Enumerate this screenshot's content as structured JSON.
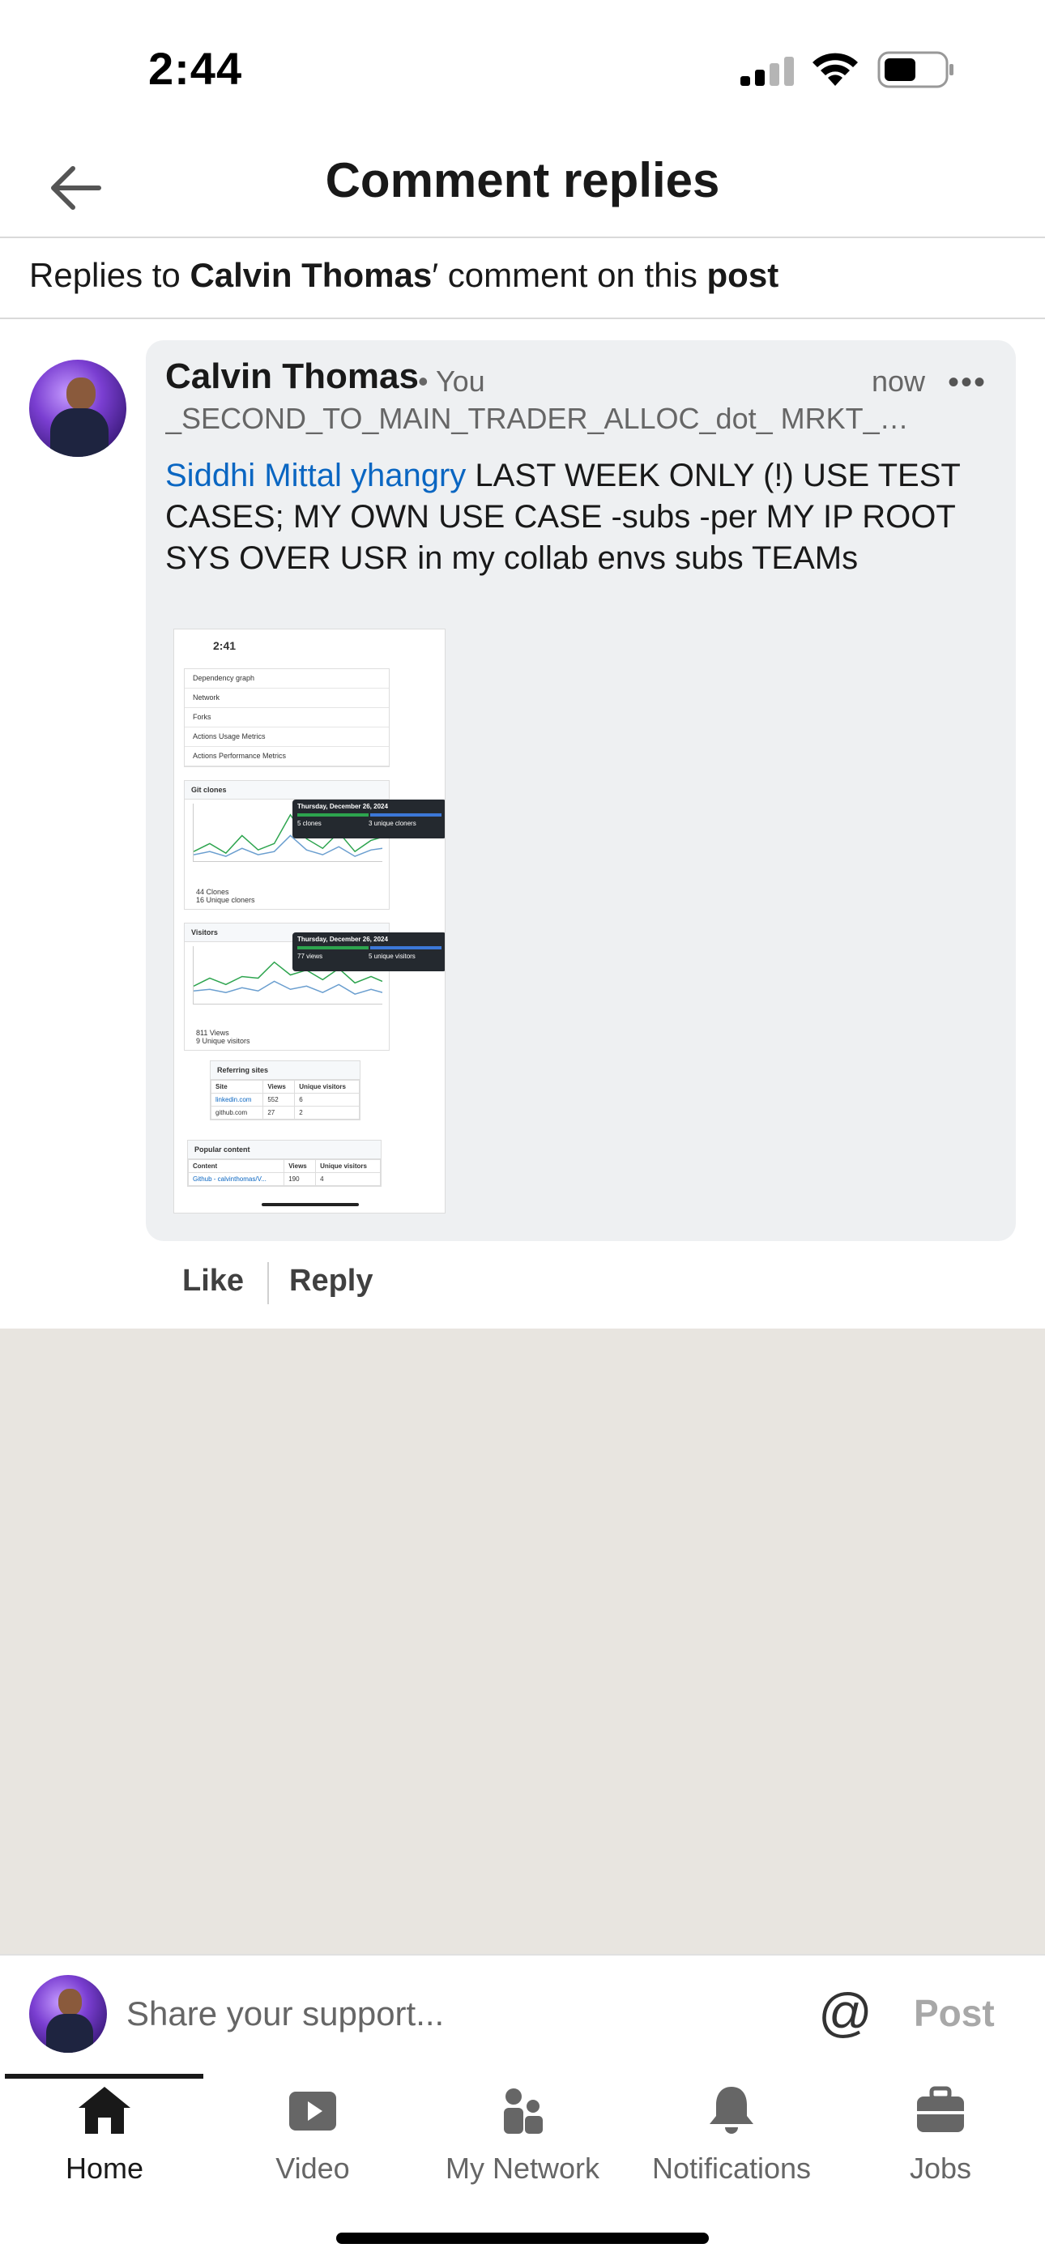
{
  "status_bar": {
    "time": "2:44"
  },
  "header": {
    "title": "Comment replies"
  },
  "context": {
    "prefix": "Replies to ",
    "author": "Calvin Thomas",
    "middle": "′ comment on this ",
    "target": "post"
  },
  "comment": {
    "author": "Calvin Thomas",
    "relation": "• You",
    "timestamp": "now",
    "headline": "_SECOND_TO_MAIN_TRADER_ALLOC_dot_ MRKT_d...",
    "mention": "Siddhi Mittal yhangry",
    "body": " LAST WEEK ONLY (!) USE TEST CASES; MY OWN USE CASE -subs -per MY IP ROOT SYS OVER USR in my collab envs subs TEAMs",
    "actions": {
      "like": "Like",
      "reply": "Reply"
    }
  },
  "attachment": {
    "time": "2:41",
    "menu": [
      "Dependency graph",
      "Network",
      "Forks",
      "Actions Usage Metrics",
      "Actions Performance Metrics"
    ],
    "clones_panel": {
      "title": "Git clones",
      "tip_date": "Thursday, December 26, 2024",
      "tip_left": "5 clones",
      "tip_right": "3 unique cloners",
      "total": "44 Clones",
      "unique": "16 Unique cloners"
    },
    "visitors_panel": {
      "title": "Visitors",
      "tip_date": "Thursday, December 26, 2024",
      "tip_left": "77 views",
      "tip_right": "5 unique visitors",
      "total": "811 Views",
      "unique": "9 Unique visitors"
    },
    "referring": {
      "title": "Referring sites",
      "headers": [
        "Site",
        "Views",
        "Unique visitors"
      ],
      "rows": [
        [
          "linkedin.com",
          "552",
          "6"
        ],
        [
          "github.com",
          "27",
          "2"
        ]
      ]
    },
    "popular": {
      "title": "Popular content",
      "headers": [
        "Content",
        "Views",
        "Unique visitors"
      ],
      "rows": [
        [
          "Github - calvinthomas/V...",
          "190",
          "4"
        ]
      ]
    }
  },
  "composer": {
    "placeholder": "Share your support...",
    "at_symbol": "@",
    "post_label": "Post"
  },
  "tabs": [
    {
      "label": "Home",
      "icon": "home-icon",
      "active": true
    },
    {
      "label": "Video",
      "icon": "video-icon",
      "active": false
    },
    {
      "label": "My Network",
      "icon": "network-icon",
      "active": false
    },
    {
      "label": "Notifications",
      "icon": "bell-icon",
      "active": false
    },
    {
      "label": "Jobs",
      "icon": "briefcase-icon",
      "active": false
    }
  ],
  "colors": {
    "link": "#0a66c2",
    "feed_background": "#e8e5e0",
    "bubble": "#eef0f2"
  }
}
